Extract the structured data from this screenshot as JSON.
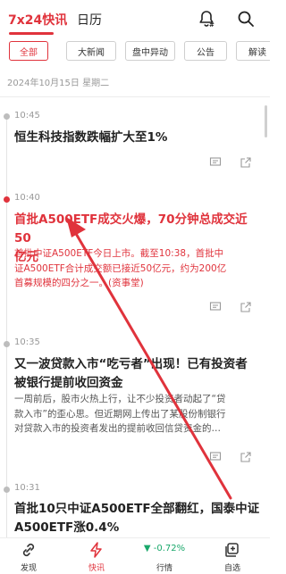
{
  "top_tabs": {
    "active_label": "7x24快讯",
    "other_label": "日历"
  },
  "chips": [
    "全部",
    "大新闻",
    "盘中异动",
    "公告",
    "解读"
  ],
  "date_line": "2024年10月15日 星期二",
  "feed": [
    {
      "time": "10:45",
      "title": "恒生科技指数跌幅扩大至1%",
      "body_lines": []
    },
    {
      "time": "10:40",
      "title_lines": [
        "首批A500ETF成交火爆，70分钟总成交近50",
        "亿元"
      ],
      "body_lines": [
        "首批中证A500ETF今日上市。截至10:38，首批中",
        "证A500ETF合计成交额已接近50亿元，约为200亿",
        "首募规模的四分之一。(资事堂)"
      ]
    },
    {
      "time": "10:35",
      "title_lines": [
        "又一波贷款入市“吃亏者”出现！已有投资者",
        "被银行提前收回资金"
      ],
      "body_lines": [
        "一周前后，股市火热上行，让不少投资者动起了“贷",
        "款入市”的歪心思。但近期网上传出了某股份制银行",
        "对贷款入市的投资者发出的提前收回信贷资金的…"
      ]
    },
    {
      "time": "10:31",
      "title_lines": [
        "首批10只中证A500ETF全部翻红，国泰中证",
        "A500ETF涨0.4%"
      ],
      "body_lines": []
    }
  ],
  "bottom_nav": {
    "discover": "发现",
    "flash": "快讯",
    "market": "行情",
    "market_change": "▼ -0.72%",
    "watchlist": "自选"
  },
  "colors": {
    "accent": "#e0333c",
    "down_green": "#1aa86b"
  }
}
